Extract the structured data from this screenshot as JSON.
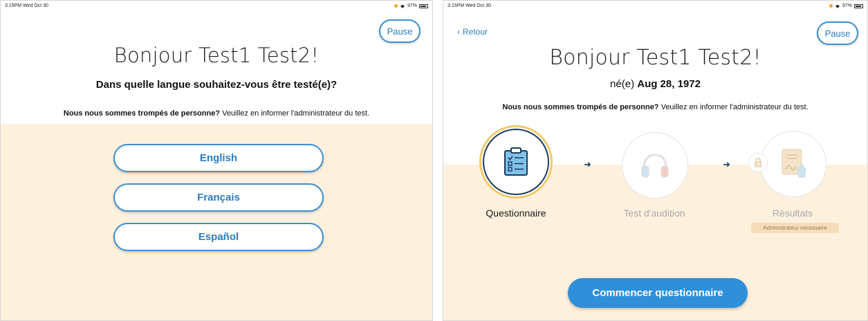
{
  "left_screen": {
    "status_bar": {
      "time": "3:15PM  Wed Oct 30",
      "battery": "97%"
    },
    "pause_label": "Pause",
    "title": "Bonjour Test1 Test2!",
    "question": "Dans quelle langue souhaitez-vous être testé(e)?",
    "notice_bold": "Nous nous sommes trompés de personne?",
    "notice_rest": " Veuillez en informer l'administrateur du test.",
    "languages": [
      "English",
      "Français",
      "Español"
    ]
  },
  "right_screen": {
    "status_bar": {
      "time": "3:15PM  Wed Oct 30",
      "battery": "97%"
    },
    "back_label": "Retour",
    "pause_label": "Pause",
    "title": "Bonjour Test1 Test2!",
    "dob_prefix": "né(e) ",
    "dob_value": "Aug 28, 1972",
    "notice_bold": "Nous nous sommes trompés de personne?",
    "notice_rest": " Veuillez en informer l'administrateur du test.",
    "steps": [
      {
        "label": "Questionnaire",
        "icon": "clipboard-icon",
        "state": "active"
      },
      {
        "label": "Test d'audition",
        "icon": "headphones-icon",
        "state": "disabled"
      },
      {
        "label": "Résultats",
        "icon": "signed-document-icon",
        "state": "locked",
        "badge": "Administrateur nécessaire"
      }
    ],
    "start_button": "Commencer questionnaire"
  },
  "colors": {
    "accent_blue": "#2f8fd8",
    "cream_background": "#fdf1de",
    "active_ring": "#f3c969",
    "navy": "#1c3b5e",
    "admin_badge": "#f6dcba"
  }
}
